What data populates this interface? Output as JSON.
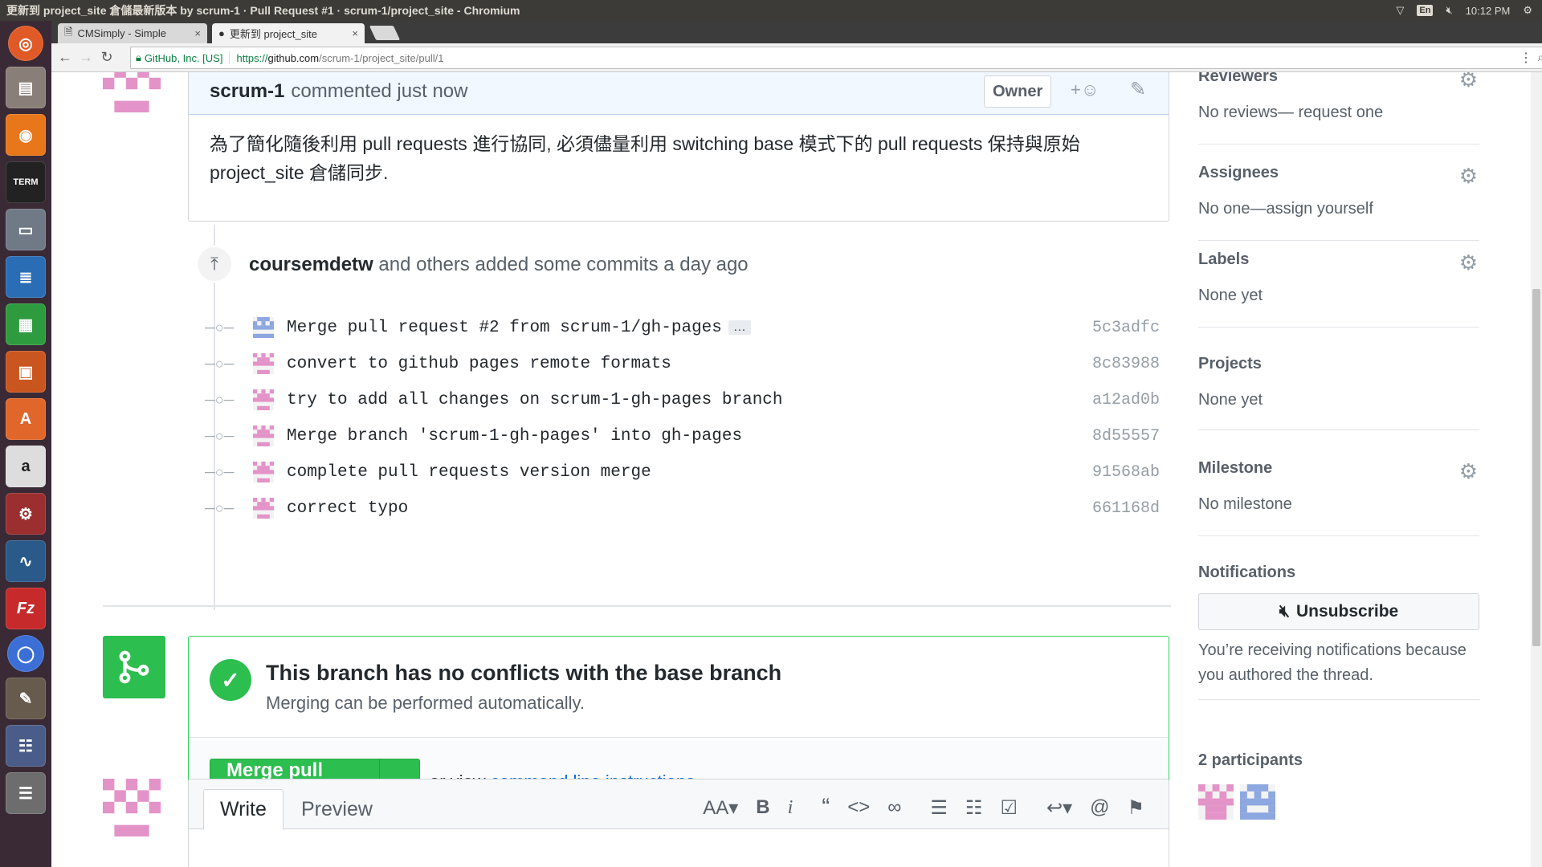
{
  "window": {
    "title": "更新到 project_site 倉儲最新版本 by scrum-1 · Pull Request #1 · scrum-1/project_site - Chromium",
    "time": "10:12 PM",
    "lang": "En"
  },
  "browser": {
    "tabs": [
      {
        "label": "CMSimply - Simple"
      },
      {
        "label": "更新到 project_site"
      }
    ],
    "secure_label": "GitHub, Inc. [US]",
    "url_scheme": "https://",
    "url_host": "github.com",
    "url_path": "/scrum-1/project_site/pull/1"
  },
  "comment": {
    "author": "scrum-1",
    "action": "commented just now",
    "owner_badge": "Owner",
    "body": "為了簡化隨後利用 pull requests 進行協同, 必須儘量利用 switching base 模式下的 pull requests 保持與原始 project_site 倉儲同步."
  },
  "commits": {
    "header_author": "coursemdetw",
    "header_rest": "and others added some commits a day ago",
    "items": [
      {
        "message": "Merge pull request #2 from scrum-1/gh-pages",
        "sha": "5c3adfc",
        "more": "…"
      },
      {
        "message": "convert to github pages remote formats",
        "sha": "8c83988"
      },
      {
        "message": "try to add all changes on scrum-1-gh-pages branch",
        "sha": "a12ad0b"
      },
      {
        "message": "Merge branch 'scrum-1-gh-pages' into gh-pages",
        "sha": "8d55557"
      },
      {
        "message": "complete pull requests version merge",
        "sha": "91568ab"
      },
      {
        "message": "correct typo",
        "sha": "661168d"
      }
    ]
  },
  "merge": {
    "title": "This branch has no conflicts with the base branch",
    "subtitle": "Merging can be performed automatically.",
    "button": "Merge pull request",
    "or_view": "or view",
    "link": "command line instructions",
    "period": "."
  },
  "editor": {
    "tab_write": "Write",
    "tab_preview": "Preview",
    "tools": {
      "heading": "AA",
      "bold": "B",
      "italic": "i"
    }
  },
  "sidebar": {
    "reviewers": {
      "title": "Reviewers",
      "value": "No reviews— request one"
    },
    "assignees": {
      "title": "Assignees",
      "value": "No one—assign yourself"
    },
    "labels": {
      "title": "Labels",
      "value": "None yet"
    },
    "projects": {
      "title": "Projects",
      "value": "None yet"
    },
    "milestone": {
      "title": "Milestone",
      "value": "No milestone"
    },
    "notifications": {
      "title": "Notifications",
      "button": "Unsubscribe",
      "reason": "You’re receiving notifications because you authored the thread."
    },
    "participants": {
      "title": "2 participants"
    }
  },
  "colors": {
    "green": "#2cbe4e",
    "link": "#0366d6",
    "identicon_pink": "#e393c8",
    "identicon_blue": "#8da7e0"
  }
}
